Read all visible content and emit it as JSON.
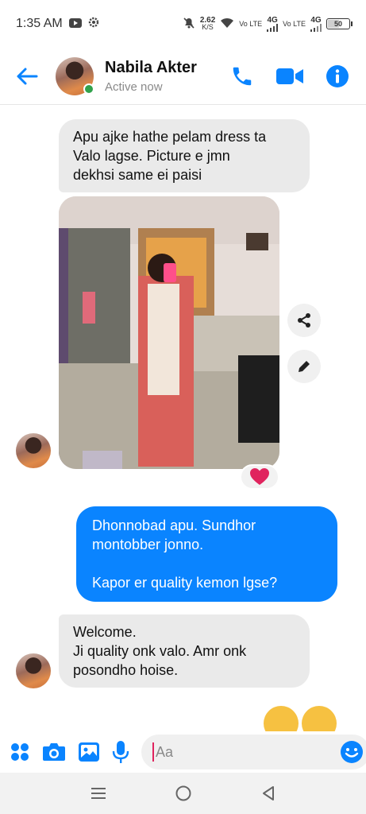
{
  "status_bar": {
    "time": "1:35 AM",
    "net_speed": "2.62",
    "net_unit": "K/S",
    "sim1_label": "Vo LTE",
    "sim1_gen": "4G",
    "sim2_label": "Vo LTE",
    "sim2_gen": "4G",
    "battery_percent": "50"
  },
  "header": {
    "contact_name": "Nabila Akter",
    "presence": "Active now"
  },
  "messages": {
    "m1": {
      "line1": "Apu ajke hathe pelam dress ta",
      "line2": "Valo lagse. Picture e jmn",
      "line3": "dekhsi same ei paisi"
    },
    "photo_reaction": "heart",
    "m2": {
      "line1": "Dhonnobad apu. Sundhor",
      "line2": "montobber jonno.",
      "line3": "Kapor er quality kemon lgse?"
    },
    "m3": {
      "line1": "Welcome.",
      "line2": "Ji quality onk valo. Amr onk",
      "line3": "posondho hoise."
    }
  },
  "composer": {
    "placeholder": "Aa"
  },
  "colors": {
    "accent": "#0a84ff",
    "incoming_bubble": "#eaeaea",
    "online": "#31a24c",
    "reaction_heart": "#e0245e"
  },
  "icons": {
    "back": "arrow-left-icon",
    "call": "phone-icon",
    "video": "video-camera-icon",
    "info": "info-icon",
    "share": "share-icon",
    "edit": "pencil-icon",
    "apps": "grid-dots-icon",
    "camera": "camera-icon",
    "gallery": "image-icon",
    "mic": "microphone-icon",
    "emoji": "smiley-icon",
    "like": "thumbs-up-icon"
  }
}
